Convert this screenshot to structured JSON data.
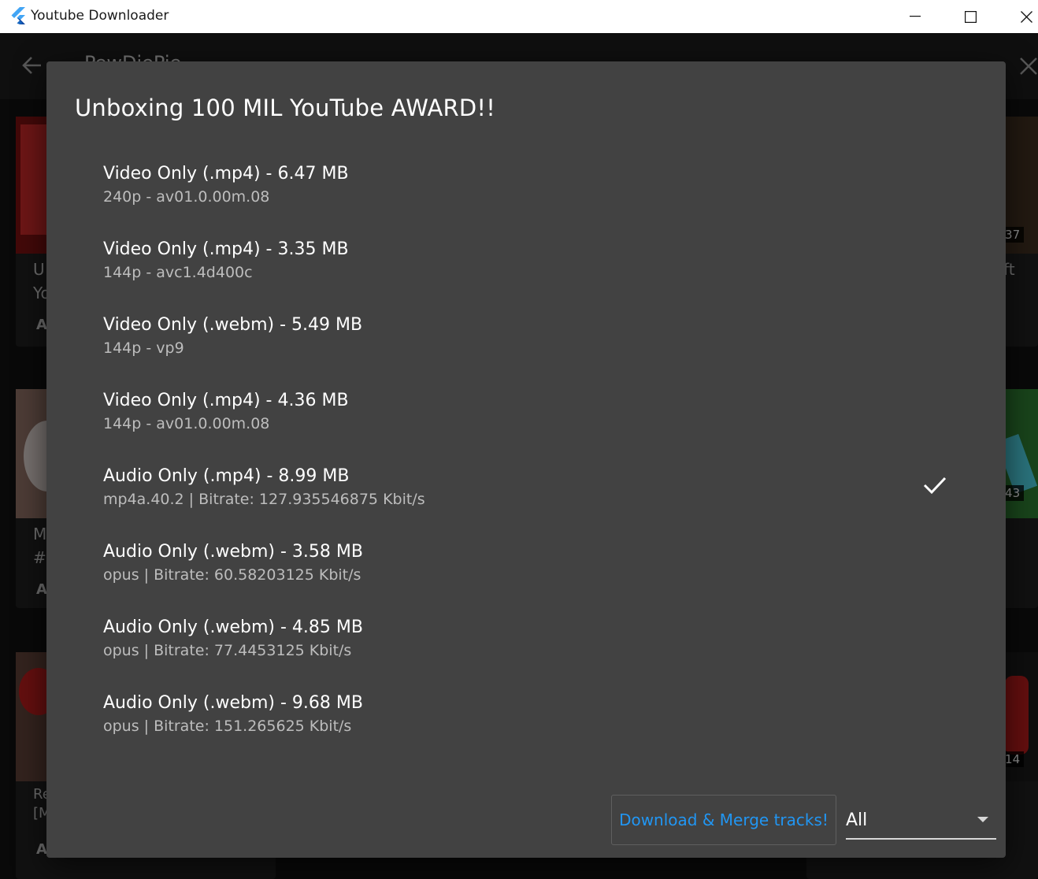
{
  "window": {
    "title": "Youtube Downloader"
  },
  "app": {
    "playlist_title": "PewDiePie",
    "cards": [
      {
        "line1": "U",
        "line2": "Yo",
        "author": "A"
      },
      {
        "line1": "M",
        "line2": "#1",
        "author": "A"
      },
      {
        "line1": "Re",
        "line2": "[M",
        "author": "A"
      }
    ],
    "right_cards": [
      {
        "line1": "ft",
        "duration": ":37"
      },
      {
        "duration": ":43"
      },
      {
        "duration": ":14"
      }
    ]
  },
  "dialog": {
    "title": "Unboxing 100 MIL YouTube AWARD!!",
    "streams": [
      {
        "title": "Video Only (.mp4) - 6.47 MB",
        "subtitle": "240p - av01.0.00m.08",
        "selected": false
      },
      {
        "title": "Video Only (.mp4) - 3.35 MB",
        "subtitle": "144p - avc1.4d400c",
        "selected": false
      },
      {
        "title": "Video Only (.webm) - 5.49 MB",
        "subtitle": "144p - vp9",
        "selected": false
      },
      {
        "title": "Video Only (.mp4) - 4.36 MB",
        "subtitle": "144p - av01.0.00m.08",
        "selected": false
      },
      {
        "title": "Audio Only (.mp4) - 8.99 MB",
        "subtitle": "mp4a.40.2 | Bitrate: 127.935546875 Kbit/s",
        "selected": true
      },
      {
        "title": "Audio Only (.webm) - 3.58 MB",
        "subtitle": "opus | Bitrate: 60.58203125 Kbit/s",
        "selected": false
      },
      {
        "title": "Audio Only (.webm) - 4.85 MB",
        "subtitle": "opus | Bitrate: 77.4453125 Kbit/s",
        "selected": false
      },
      {
        "title": "Audio Only (.webm) - 9.68 MB",
        "subtitle": "opus | Bitrate: 151.265625 Kbit/s",
        "selected": false
      }
    ],
    "download_button": "Download & Merge tracks!",
    "filter": {
      "selected": "All"
    },
    "accent_color": "#2196f3"
  }
}
